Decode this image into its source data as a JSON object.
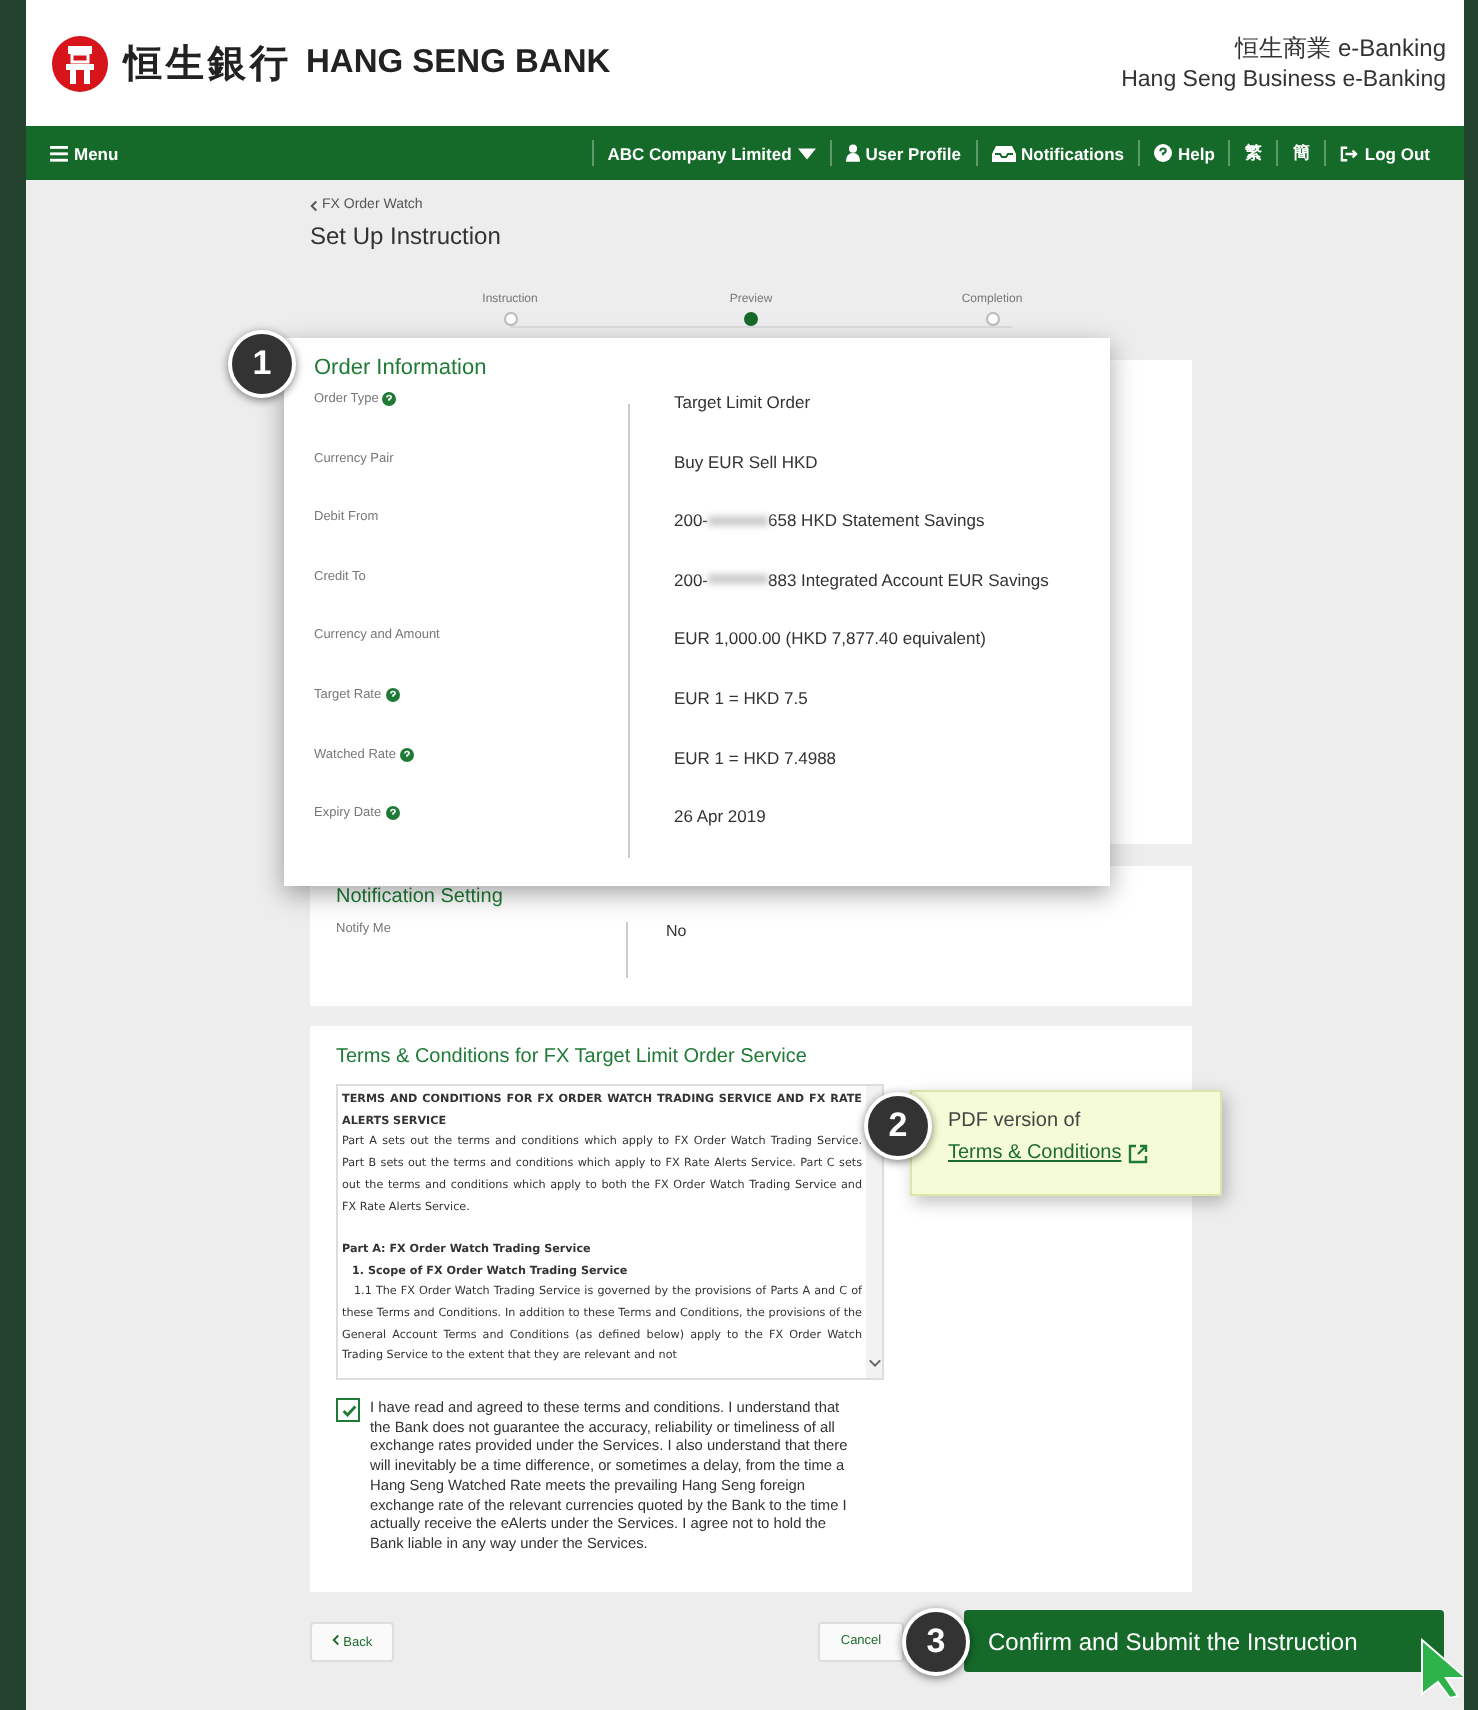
{
  "header": {
    "logo_text": "恒生銀行",
    "bank_name": "HANG SENG BANK",
    "service_zh": "恒生商業 e-Banking",
    "service_en": "Hang Seng Business e-Banking"
  },
  "nav": {
    "menu": "Menu",
    "items": [
      {
        "kind": "company",
        "label": "ABC Company Limited"
      },
      {
        "kind": "profile",
        "label": "User Profile"
      },
      {
        "kind": "notifications",
        "label": "Notifications"
      },
      {
        "kind": "help",
        "label": "Help"
      },
      {
        "kind": "language",
        "label": "繁"
      },
      {
        "kind": "language",
        "label": "簡"
      },
      {
        "kind": "logout",
        "label": "Log Out"
      }
    ]
  },
  "breadcrumb": "FX Order Watch",
  "title": "Set Up Instruction",
  "steps": [
    {
      "label": "Instruction",
      "selected": false
    },
    {
      "label": "Preview",
      "selected": true
    },
    {
      "label": "Completion",
      "selected": false
    }
  ],
  "order_info": {
    "callout": "1",
    "title": "Order Information",
    "rows": [
      {
        "label": "Order Type",
        "help": true,
        "value": "Target Limit Order"
      },
      {
        "label": "Currency Pair",
        "help": false,
        "value": "Buy EUR Sell HKD"
      },
      {
        "label": "Debit From",
        "help": false,
        "value": "200-",
        "masked": true,
        "value_end": "658 HKD Statement Savings"
      },
      {
        "label": "Credit To",
        "help": false,
        "value": "200-",
        "masked": true,
        "value_end": "883 Integrated Account EUR Savings"
      },
      {
        "label": "Currency and Amount",
        "help": false,
        "value": "EUR 1,000.00 (HKD 7,877.40 equivalent)"
      },
      {
        "label": "Target Rate",
        "help": true,
        "value": "EUR 1 = HKD 7.5"
      },
      {
        "label": "Watched Rate",
        "help": true,
        "value": "EUR 1 = HKD 7.4988"
      },
      {
        "label": "Expiry Date",
        "help": true,
        "value": "26 Apr 2019"
      }
    ]
  },
  "notification": {
    "title": "Notification Setting",
    "rows": [
      {
        "label": "Notify Me",
        "value": "No"
      }
    ]
  },
  "terms": {
    "title": "Terms & Conditions for FX Target Limit Order Service",
    "document": [
      {
        "kind": "heading",
        "text": "TERMS AND CONDITIONS FOR FX ORDER WATCH TRADING SERVICE AND FX RATE ALERTS SERVICE"
      },
      {
        "kind": "paragraph",
        "text": "Part A sets out the terms and conditions which apply to FX Order Watch Trading Service. Part B sets out the terms and conditions which apply to FX Rate Alerts Service. Part C sets out the terms and conditions which apply to both the FX Order Watch Trading Service and FX Rate Alerts Service."
      },
      {
        "kind": "part",
        "text": "Part A:  FX Order Watch Trading Service"
      },
      {
        "kind": "section",
        "text": "1.  Scope of FX Order Watch Trading Service"
      },
      {
        "kind": "clause",
        "text": "1.1  The FX Order Watch Trading Service is governed by the provisions of Parts A and C of these Terms and Conditions. In addition to these Terms and Conditions, the provisions of the General Account Terms and Conditions (as defined below) apply to the FX Order Watch Trading Service to the extent that they are relevant and not"
      }
    ],
    "agree": {
      "checked": true,
      "text": "I have read and agreed to these terms and conditions. I understand that the Bank does not guarantee the accuracy, reliability or timeliness of all exchange rates provided under the Services. I also understand that there will inevitably be a time difference, or sometimes a delay, from the time a Hang Seng Watched Rate meets the prevailing Hang Seng foreign exchange rate of the relevant currencies quoted by the Bank to the time I actually receive the eAlerts under the Services. I agree not to hold the Bank liable in any way under the Services."
    },
    "tooltip": {
      "callout": "2",
      "text": "PDF version of",
      "link": "Terms & Conditions"
    }
  },
  "buttons": {
    "back": "Back",
    "cancel": "Cancel",
    "confirm": "Confirm and Submit the Instruction",
    "callout": "3"
  }
}
